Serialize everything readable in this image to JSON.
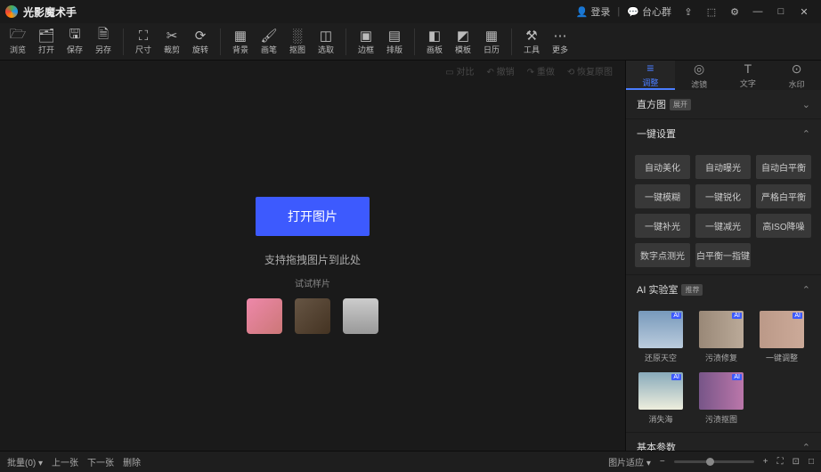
{
  "app": {
    "title": "光影魔术手"
  },
  "header": {
    "login": "登录",
    "feedback": "台心群"
  },
  "toolbar": {
    "groups": [
      [
        {
          "icon": "folder-open-icon",
          "glyph": "🗁",
          "label": "浏览"
        },
        {
          "icon": "open-icon",
          "glyph": "🗂",
          "label": "打开"
        },
        {
          "icon": "save-icon",
          "glyph": "🖫",
          "label": "保存"
        },
        {
          "icon": "save-as-icon",
          "glyph": "🗎",
          "label": "另存"
        }
      ],
      [
        {
          "icon": "resize-icon",
          "glyph": "⛶",
          "label": "尺寸"
        },
        {
          "icon": "crop-icon",
          "glyph": "✂",
          "label": "裁剪"
        },
        {
          "icon": "rotate-icon",
          "glyph": "⟳",
          "label": "旋转"
        }
      ],
      [
        {
          "icon": "grid-icon",
          "glyph": "▦",
          "label": "背景"
        },
        {
          "icon": "brush-icon",
          "glyph": "🖌",
          "label": "画笔"
        },
        {
          "icon": "erase-icon",
          "glyph": "░",
          "label": "抠图"
        },
        {
          "icon": "select-icon",
          "glyph": "◫",
          "label": "选取"
        }
      ],
      [
        {
          "icon": "border-icon",
          "glyph": "▣",
          "label": "边框"
        },
        {
          "icon": "layout-icon",
          "glyph": "▤",
          "label": "排版"
        }
      ],
      [
        {
          "icon": "panel-icon",
          "glyph": "◧",
          "label": "画板"
        },
        {
          "icon": "template-icon",
          "glyph": "◩",
          "label": "模板"
        },
        {
          "icon": "calendar-icon",
          "glyph": "▦",
          "label": "日历"
        }
      ],
      [
        {
          "icon": "tools-icon",
          "glyph": "⚒",
          "label": "工具"
        },
        {
          "icon": "more-icon",
          "glyph": "⋯",
          "label": "更多"
        }
      ]
    ]
  },
  "canvas": {
    "top": {
      "compare": "对比",
      "undo": "撤销",
      "redo": "重做",
      "reset": "恢复原图"
    },
    "open_button": "打开图片",
    "drag_hint": "支持拖拽图片到此处",
    "trial": "试试样片"
  },
  "sidebar": {
    "tabs": [
      {
        "icon": "adjust-icon",
        "glyph": "≡",
        "label": "调整",
        "active": true
      },
      {
        "icon": "filter-icon",
        "glyph": "◎",
        "label": "滤镜"
      },
      {
        "icon": "text-icon",
        "glyph": "T",
        "label": "文字"
      },
      {
        "icon": "watermark-icon",
        "glyph": "⊙",
        "label": "水印"
      }
    ],
    "histogram": {
      "title": "直方图",
      "badge": "展开"
    },
    "quick": {
      "title": "一键设置",
      "buttons": [
        "自动美化",
        "自动曝光",
        "自动白平衡",
        "一键模糊",
        "一键锐化",
        "严格白平衡",
        "一键补光",
        "一键减光",
        "高ISO降噪",
        "数字点测光",
        "白平衡一指键"
      ]
    },
    "ai": {
      "title": "AI 实验室",
      "badge": "推荐",
      "items": [
        {
          "cls": "a1",
          "label": "还原天空"
        },
        {
          "cls": "a2",
          "label": "污渍修复"
        },
        {
          "cls": "a3",
          "label": "一键调整"
        },
        {
          "cls": "a4",
          "label": "消失海"
        },
        {
          "cls": "a5",
          "label": "污渍抠图"
        }
      ]
    },
    "basic": {
      "title": "基本参数"
    }
  },
  "statusbar": {
    "batch": "批量(0)",
    "prev": "上一张",
    "next": "下一张",
    "delete": "删除",
    "fit": "图片适应",
    "zoom_icons": [
      "−",
      "⛶",
      "⊡",
      "□",
      "+"
    ]
  }
}
